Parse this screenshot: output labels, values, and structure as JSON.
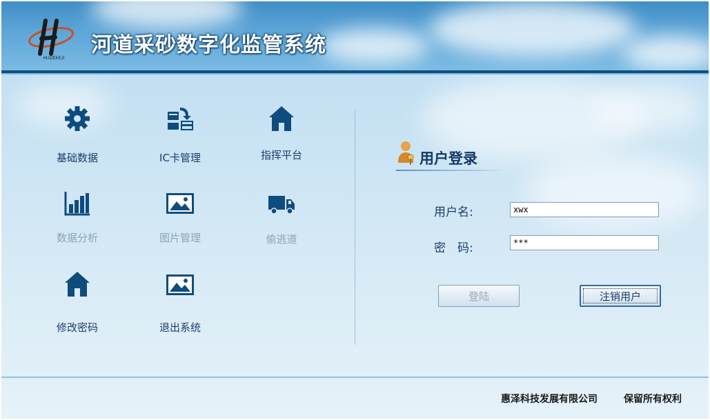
{
  "header": {
    "logo_text": "HUIZEKEJI",
    "title": "河道采砂数字化监管系统"
  },
  "menu": [
    {
      "label": "基础数据",
      "icon": "gear-icon",
      "enabled": true
    },
    {
      "label": "IC卡管理",
      "icon": "card-transfer-icon",
      "enabled": true
    },
    {
      "label": "指挥平台",
      "icon": "home-icon",
      "enabled": true
    },
    {
      "label": "数据分析",
      "icon": "bar-chart-icon",
      "enabled": false
    },
    {
      "label": "图片管理",
      "icon": "image-icon",
      "enabled": false
    },
    {
      "label": "偷逃道",
      "icon": "truck-icon",
      "enabled": false
    },
    {
      "label": "修改密码",
      "icon": "home-icon",
      "enabled": true
    },
    {
      "label": "退出系统",
      "icon": "image-icon",
      "enabled": true
    }
  ],
  "login": {
    "title": "用户登录",
    "username_label": "用户名:",
    "username_value": "xwx",
    "password_label": "密　码:",
    "password_value": "***",
    "login_button": "登陆",
    "logout_button": "注销用户"
  },
  "footer": {
    "company": "惠泽科技发展有限公司",
    "rights": "保留所有权利"
  },
  "colors": {
    "icon": "#0f4c7e",
    "header_bar": "#0e4f7f",
    "label_text": "#1b3e6d",
    "disabled_text": "#8ea3b5"
  }
}
